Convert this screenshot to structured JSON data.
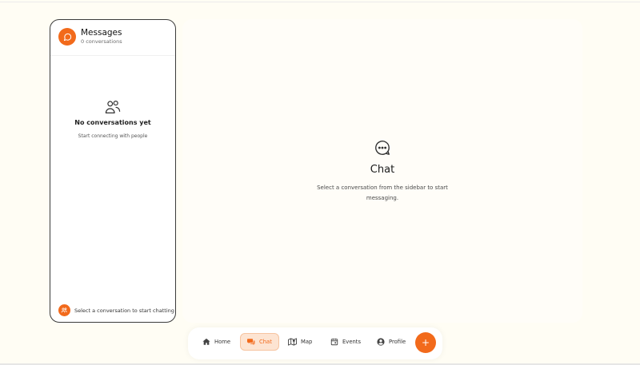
{
  "sidebar": {
    "title": "Messages",
    "subtitle": "0 conversations",
    "empty_title": "No conversations yet",
    "empty_subtitle": "Start connecting with people",
    "footer_text": "Select a conversation to start chatting"
  },
  "main": {
    "title": "Chat",
    "description": "Select a conversation from the sidebar to start messaging."
  },
  "nav": {
    "items": [
      {
        "label": "Home",
        "icon": "home-icon"
      },
      {
        "label": "Chat",
        "icon": "chat-icon",
        "active": true
      },
      {
        "label": "Map",
        "icon": "map-icon"
      },
      {
        "label": "Events",
        "icon": "calendar-icon"
      },
      {
        "label": "Profile",
        "icon": "user-circle-icon"
      }
    ],
    "fab_label": "+"
  },
  "colors": {
    "accent": "#f26a1b",
    "active_bg": "#fde4d2",
    "background": "#fffdf4"
  }
}
